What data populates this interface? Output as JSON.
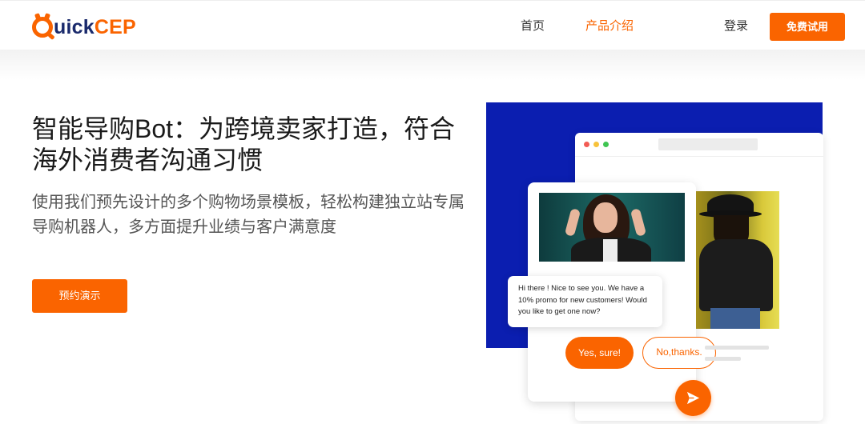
{
  "brand": {
    "logo_part1": "uick",
    "logo_part2": "CEP",
    "accent_color": "#fa6400",
    "navy_color": "#1a2a6c"
  },
  "nav": {
    "home": "首页",
    "products": "产品介绍",
    "login": "登录",
    "free_trial": "免费试用"
  },
  "hero": {
    "title": "智能导购Bot：为跨境卖家打造，符合海外消费者沟通习惯",
    "subtitle": "使用我们预先设计的多个购物场景模板，轻松构建独立站专属导购机器人，多方面提升业绩与客户满意度",
    "demo_button": "预约演示"
  },
  "illustration": {
    "panel_color": "#0b1eb0",
    "chat_message": "Hi there ! Nice to see you. We have a 10% promo for new customers! Would you like to get one now?",
    "reply_yes": "Yes, sure!",
    "reply_no": "No,thanks.",
    "send_icon": "send-icon"
  }
}
